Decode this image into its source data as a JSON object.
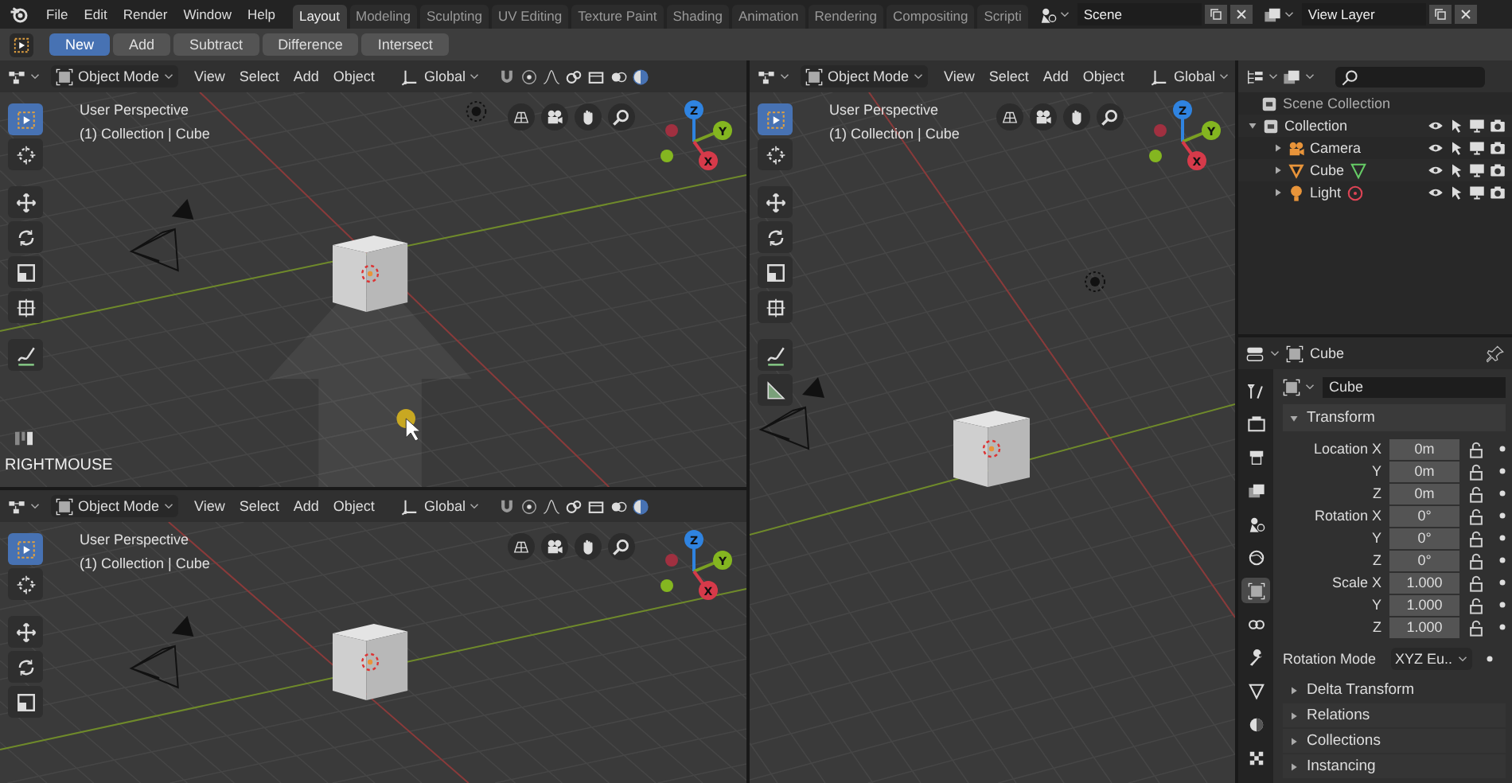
{
  "topbar": {
    "menus": [
      "File",
      "Edit",
      "Render",
      "Window",
      "Help"
    ],
    "workspaces": [
      {
        "label": "Layout",
        "selected": true
      },
      {
        "label": "Modeling",
        "selected": false
      },
      {
        "label": "Sculpting",
        "selected": false
      },
      {
        "label": "UV Editing",
        "selected": false
      },
      {
        "label": "Texture Paint",
        "selected": false
      },
      {
        "label": "Shading",
        "selected": false
      },
      {
        "label": "Animation",
        "selected": false
      },
      {
        "label": "Rendering",
        "selected": false
      },
      {
        "label": "Compositing",
        "selected": false
      },
      {
        "label": "Scripti",
        "selected": false
      }
    ],
    "scene": "Scene",
    "view_layer": "View Layer"
  },
  "tool_header": {
    "modes": [
      {
        "label": "New",
        "selected": true
      },
      {
        "label": "Add",
        "selected": false
      },
      {
        "label": "Subtract",
        "selected": false
      },
      {
        "label": "Difference",
        "selected": false
      },
      {
        "label": "Intersect",
        "selected": false
      }
    ]
  },
  "viewports": [
    {
      "mode": "Object Mode",
      "menus": [
        "View",
        "Select",
        "Add",
        "Object"
      ],
      "orientation": "Global",
      "perspective": "User Perspective",
      "collection": "(1) Collection | Cube",
      "axes": [
        "Z",
        "Y",
        "X"
      ],
      "status": "RIGHTMOUSE",
      "tools": [
        {
          "selected": true
        },
        {
          "selected": false
        },
        {
          "selected": false
        },
        {
          "selected": false
        },
        {
          "selected": false
        },
        {
          "selected": false
        },
        {
          "selected": false
        }
      ]
    },
    {
      "mode": "Object Mode",
      "menus": [
        "View",
        "Select",
        "Add",
        "Object"
      ],
      "orientation": "Global",
      "perspective": "User Perspective",
      "collection": "(1) Collection | Cube",
      "axes": [
        "Z",
        "Y",
        "X"
      ],
      "tools": [
        {
          "selected": true
        },
        {
          "selected": false
        },
        {
          "selected": false
        },
        {
          "selected": false
        },
        {
          "selected": false
        }
      ]
    },
    {
      "mode": "Object Mode",
      "menus": [
        "View",
        "Select",
        "Add",
        "Object"
      ],
      "orientation": "Global",
      "perspective": "User Perspective",
      "collection": "(1) Collection | Cube",
      "axes": [
        "Z",
        "Y",
        "X"
      ],
      "tools": [
        {
          "selected": true
        },
        {
          "selected": false
        },
        {
          "selected": false
        },
        {
          "selected": false
        },
        {
          "selected": false
        },
        {
          "selected": false
        },
        {
          "selected": false
        },
        {
          "selected": false
        }
      ]
    }
  ],
  "outliner": {
    "root": "Scene Collection",
    "items": [
      {
        "label": "Collection",
        "expanded": true,
        "children": [
          {
            "label": "Camera",
            "kind": "camera"
          },
          {
            "label": "Cube",
            "kind": "mesh"
          },
          {
            "label": "Light",
            "kind": "light"
          }
        ]
      }
    ]
  },
  "properties": {
    "object": "Cube",
    "name": "Cube",
    "tabs": [
      {
        "selected": false
      },
      {
        "selected": false
      },
      {
        "selected": false
      },
      {
        "selected": false
      },
      {
        "selected": false
      },
      {
        "selected": false
      },
      {
        "selected": true
      },
      {
        "selected": false
      },
      {
        "selected": false
      },
      {
        "selected": false
      },
      {
        "selected": false
      },
      {
        "selected": false
      }
    ],
    "panel": {
      "label": "Transform",
      "expanded": true
    },
    "fields": [
      {
        "label": "Location X",
        "value": "0m"
      },
      {
        "label": "Y",
        "value": "0m"
      },
      {
        "label": "Z",
        "value": "0m"
      },
      {
        "label": "Rotation X",
        "value": "0°"
      },
      {
        "label": "Y",
        "value": "0°"
      },
      {
        "label": "Z",
        "value": "0°"
      },
      {
        "label": "Scale X",
        "value": "1.000"
      },
      {
        "label": "Y",
        "value": "1.000"
      },
      {
        "label": "Z",
        "value": "1.000"
      }
    ],
    "rotation_mode_label": "Rotation Mode",
    "rotation_mode": "XYZ Eu..",
    "subpanels": [
      {
        "label": "Delta Transform",
        "expanded": false
      },
      {
        "label": "Relations",
        "expanded": false
      },
      {
        "label": "Collections",
        "expanded": false
      },
      {
        "label": "Instancing",
        "expanded": false
      }
    ]
  }
}
